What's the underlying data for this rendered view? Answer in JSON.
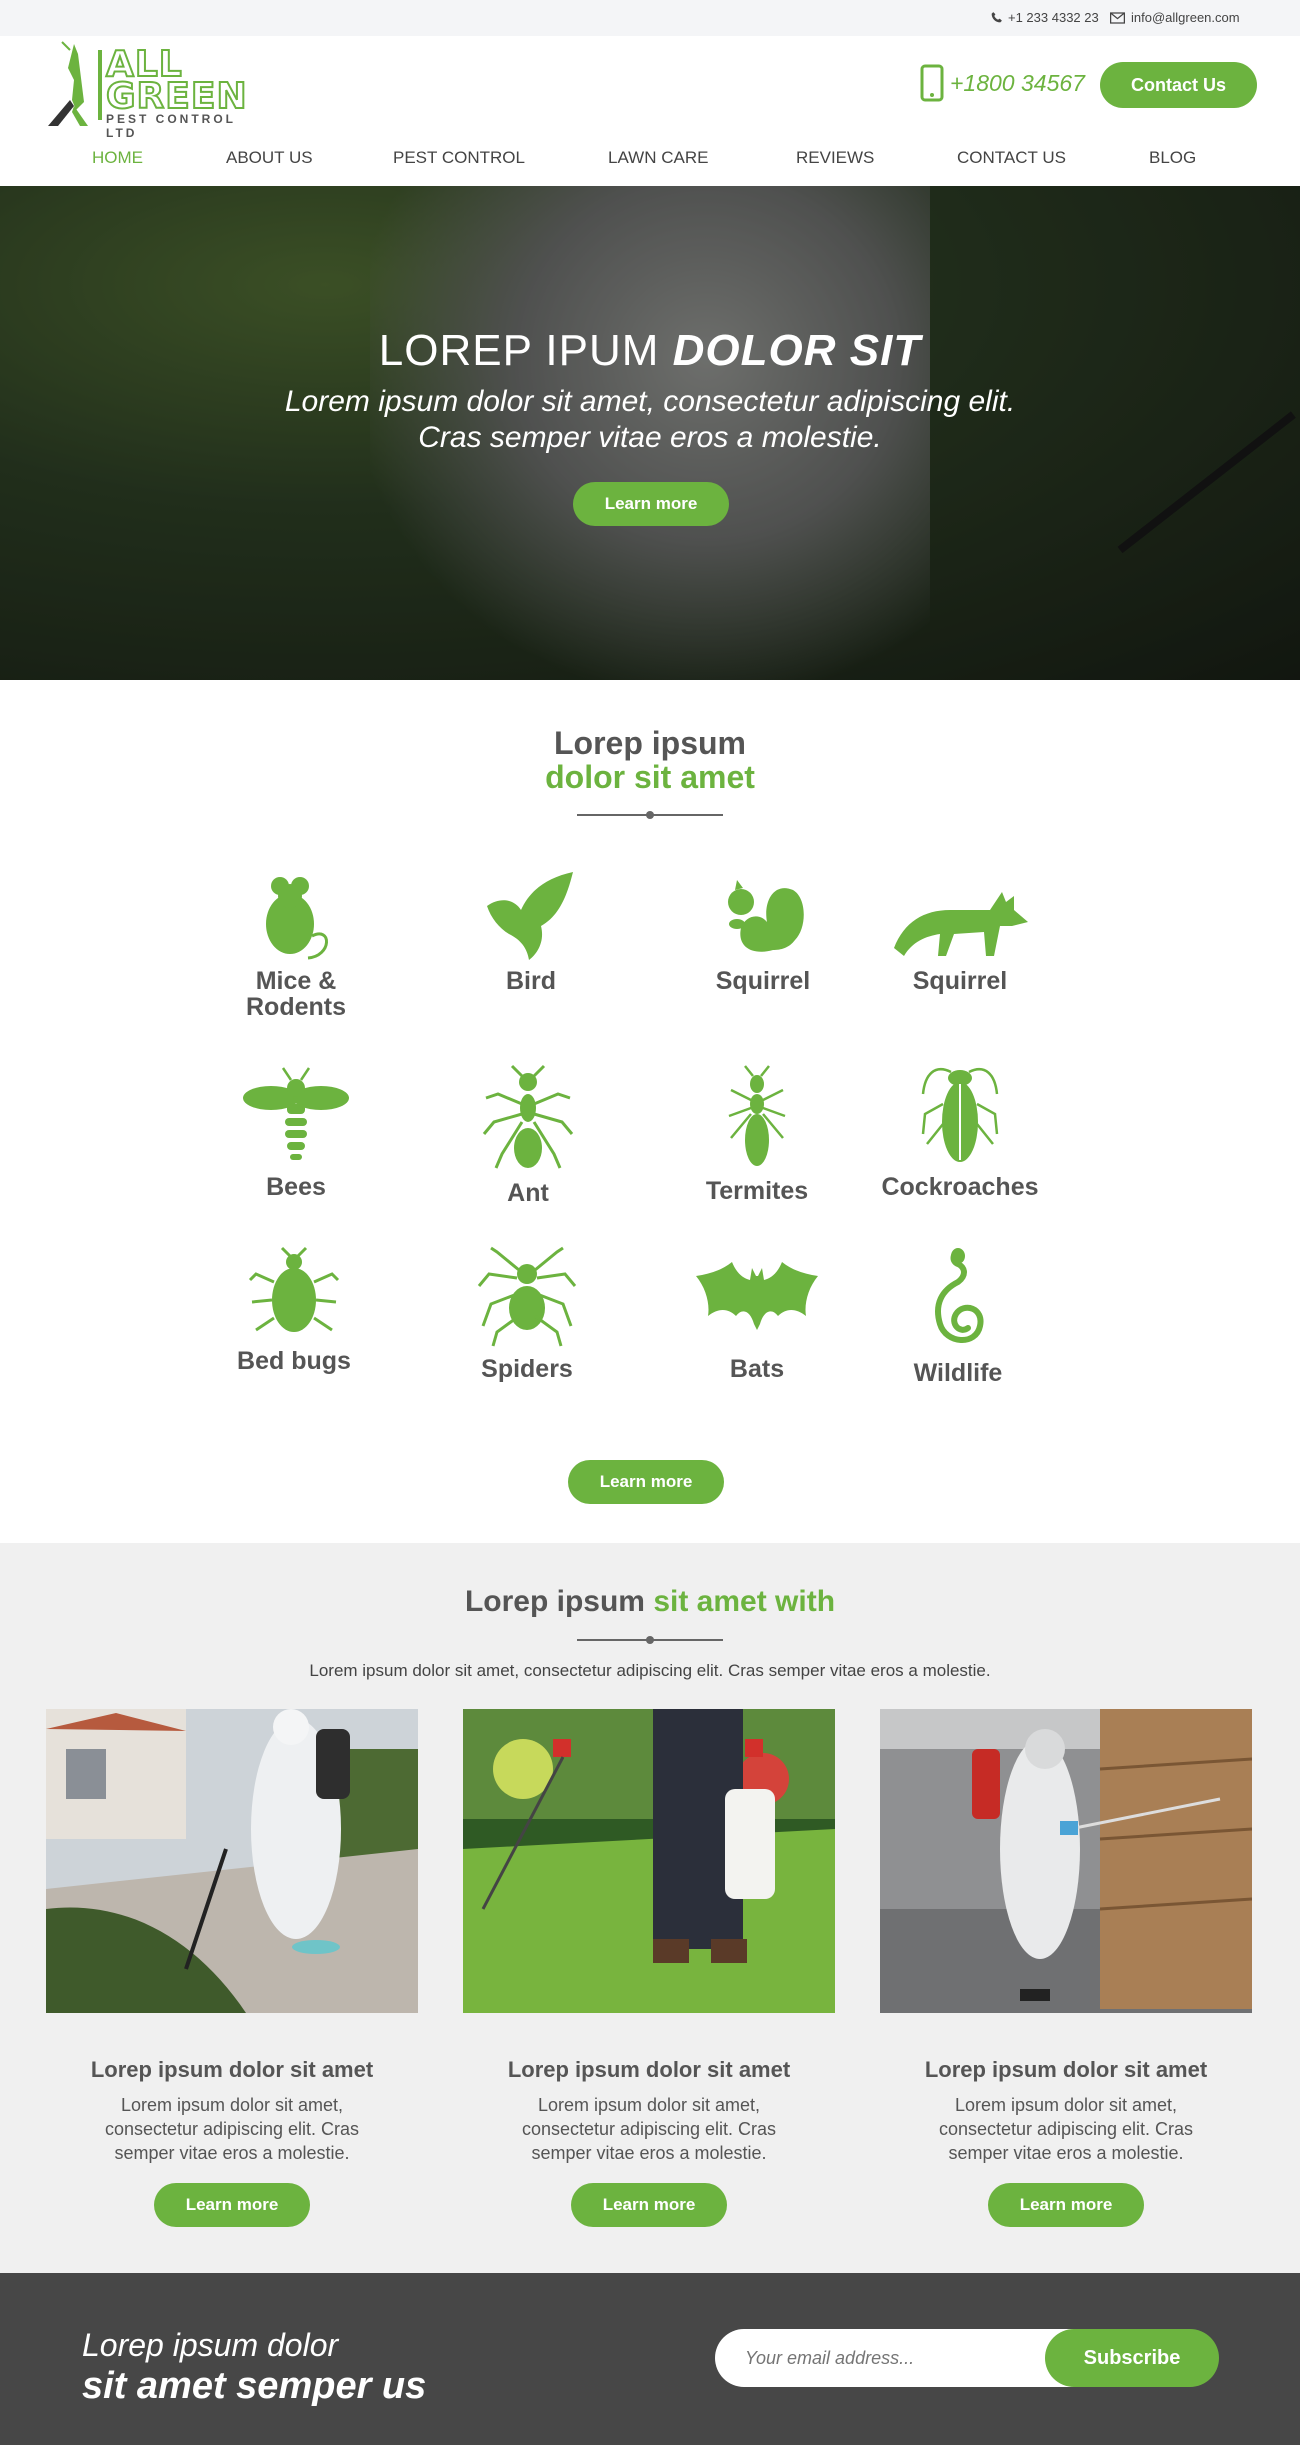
{
  "topbar": {
    "phone": "+1 233 4332 23",
    "email": "info@allgreen.com"
  },
  "logo": {
    "line1": "ALL",
    "line2": "GREEN",
    "line3": "PEST CONTROL LTD"
  },
  "header": {
    "phone": "+1800 34567",
    "contact_button": "Contact Us"
  },
  "nav": [
    "HOME",
    "ABOUT US",
    "PEST CONTROL",
    "LAWN CARE",
    "REVIEWS",
    "CONTACT US",
    "BLOG"
  ],
  "hero": {
    "title_regular": "LOREP IPUM ",
    "title_bold": "DOLOR SIT",
    "subtitle_line1": "Lorem ipsum dolor sit amet, consectetur adipiscing elit.",
    "subtitle_line2": "Cras semper vitae eros a molestie.",
    "button": "Learn more"
  },
  "pests_section": {
    "title_line1": "Lorep ipsum",
    "title_line2": "dolor sit amet",
    "items": [
      {
        "icon": "mouse-icon",
        "label": "Mice &\nRodents"
      },
      {
        "icon": "bird-icon",
        "label": "Bird"
      },
      {
        "icon": "squirrel-icon",
        "label": "Squirrel"
      },
      {
        "icon": "fox-icon",
        "label": "Squirrel"
      },
      {
        "icon": "bee-icon",
        "label": "Bees"
      },
      {
        "icon": "ant-icon",
        "label": "Ant"
      },
      {
        "icon": "termite-icon",
        "label": "Termites"
      },
      {
        "icon": "cockroach-icon",
        "label": "Cockroaches"
      },
      {
        "icon": "bedbug-icon",
        "label": "Bed bugs"
      },
      {
        "icon": "spider-icon",
        "label": "Spiders"
      },
      {
        "icon": "bat-icon",
        "label": "Bats"
      },
      {
        "icon": "snake-icon",
        "label": "Wildlife"
      }
    ],
    "button": "Learn more"
  },
  "services_section": {
    "title_regular": "Lorep ipsum ",
    "title_green": "sit amet with",
    "intro": "Lorem ipsum dolor sit amet, consectetur adipiscing elit. Cras semper vitae eros a molestie.",
    "cards": [
      {
        "title": "Lorep ipsum dolor sit amet",
        "body": "Lorem ipsum dolor sit amet, consectetur adipiscing elit. Cras semper vitae eros a molestie.",
        "button": "Learn more"
      },
      {
        "title": "Lorep ipsum dolor sit amet",
        "body": "Lorem ipsum dolor sit amet, consectetur adipiscing elit. Cras semper vitae eros a molestie.",
        "button": "Learn more"
      },
      {
        "title": "Lorep ipsum dolor sit amet",
        "body": "Lorem ipsum dolor sit amet, consectetur adipiscing elit. Cras semper vitae eros a molestie.",
        "button": "Learn more"
      }
    ]
  },
  "footer": {
    "line1": "Lorep ipsum dolor",
    "line2": "sit amet semper us",
    "email_placeholder": "Your email address...",
    "subscribe": "Subscribe"
  },
  "colors": {
    "accent": "#6cb33f",
    "footer_bg": "#474747",
    "section_bg": "#f0f0f0"
  }
}
